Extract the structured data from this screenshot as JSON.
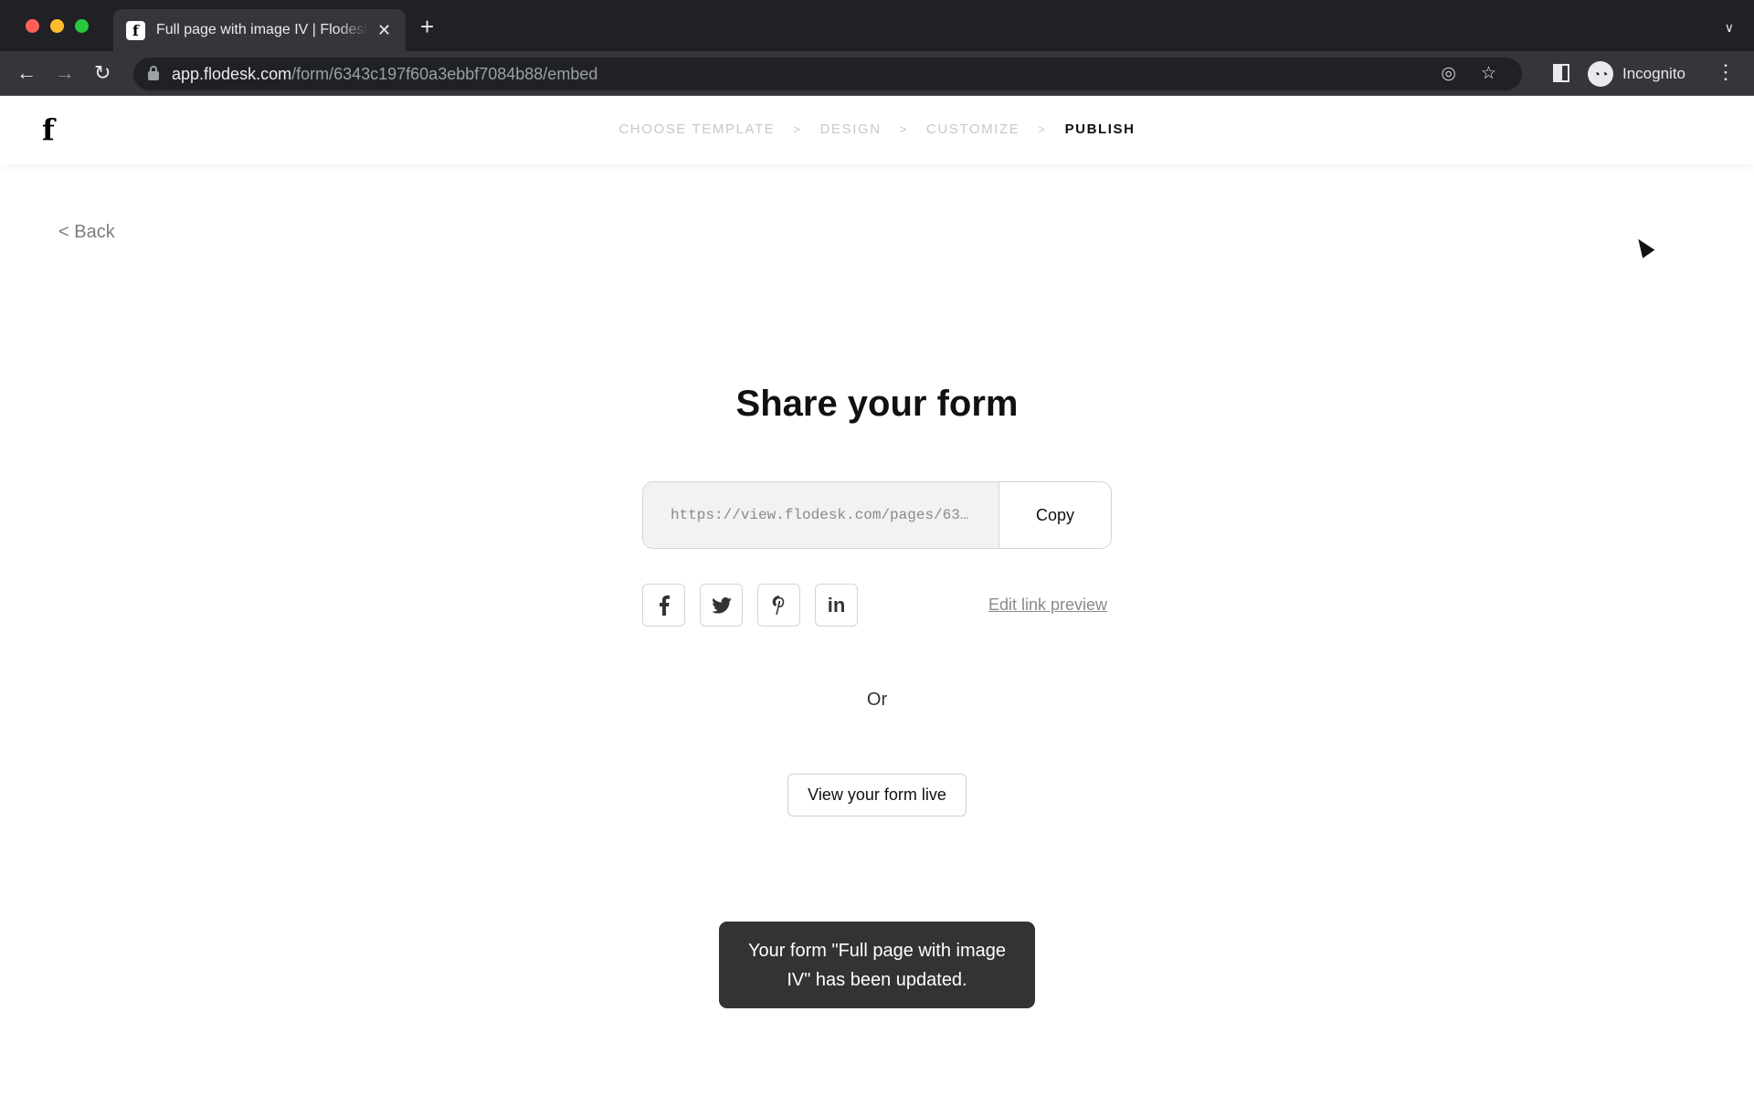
{
  "browser": {
    "tab_title": "Full page with image IV | Flodesk",
    "favicon_glyph": "f",
    "url_host": "app.flodesk.com",
    "url_path": "/form/6343c197f60a3ebbf7084b88/embed",
    "profile_label": "Incognito",
    "icons": {
      "back": "←",
      "forward": "→",
      "reload": "↻",
      "close_tab": "✕",
      "new_tab": "+",
      "tab_search": "⌄",
      "eye_off": "◎",
      "star": "☆",
      "incognito": "🕶",
      "menu": "⋮"
    }
  },
  "header": {
    "logo": "f",
    "steps": [
      {
        "label": "CHOOSE TEMPLATE",
        "active": false
      },
      {
        "label": "DESIGN",
        "active": false
      },
      {
        "label": "CUSTOMIZE",
        "active": false
      },
      {
        "label": "PUBLISH",
        "active": true
      }
    ],
    "separator": ">"
  },
  "back_link": "< Back",
  "main": {
    "title": "Share your form",
    "share_url": "https://view.flodesk.com/pages/63…",
    "copy_label": "Copy",
    "social": [
      {
        "name": "facebook",
        "glyph": "f"
      },
      {
        "name": "twitter",
        "glyph": "🐦"
      },
      {
        "name": "pinterest",
        "glyph": "P"
      },
      {
        "name": "linkedin",
        "glyph": "in"
      }
    ],
    "edit_link_label": "Edit link preview",
    "or_label": "Or",
    "view_live_label": "View your form live"
  },
  "toast": {
    "message": "Your form \"Full page with image IV\" has been updated."
  }
}
